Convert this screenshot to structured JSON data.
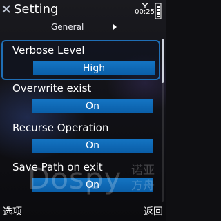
{
  "header": {
    "title": "Setting",
    "time": "00:25",
    "tab_label": "General"
  },
  "settings": [
    {
      "label": "Verbose Level",
      "value": "High",
      "selected": true
    },
    {
      "label": "Overwrite exist",
      "value": "On"
    },
    {
      "label": "Recurse Operation",
      "value": "On"
    },
    {
      "label": "Save Path on exit",
      "value": "On"
    }
  ],
  "softkeys": {
    "left": "选项",
    "right": "返回"
  },
  "watermark": {
    "text": "Dospy",
    "cn_line1": "诺亚",
    "cn_line2": "方舟"
  },
  "colors": {
    "accent": "#1f6fb6",
    "value_box": "#0a5ea8"
  },
  "icons": [
    "app-x-icon",
    "signal-antenna-icon",
    "battery-icon",
    "next-tab-arrow-icon"
  ]
}
